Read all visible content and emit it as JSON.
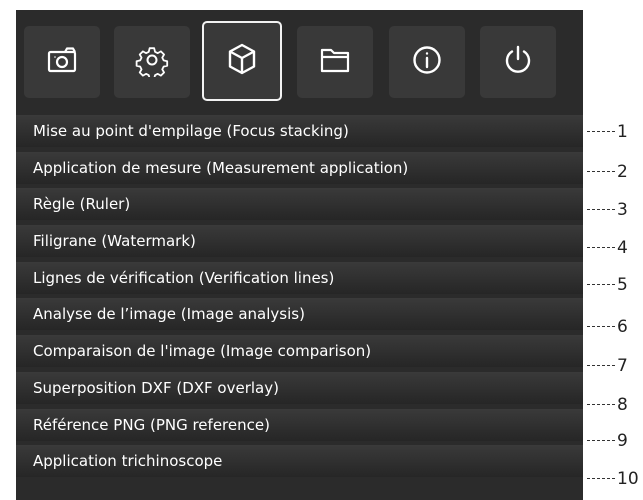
{
  "toolbar": {
    "buttons": [
      {
        "icon": "camera-icon",
        "selected": false
      },
      {
        "icon": "gear-icon",
        "selected": false
      },
      {
        "icon": "cube-icon",
        "selected": true
      },
      {
        "icon": "folder-icon",
        "selected": false
      },
      {
        "icon": "info-icon",
        "selected": false
      },
      {
        "icon": "power-icon",
        "selected": false
      }
    ]
  },
  "menu": {
    "items": [
      {
        "label": "Mise au point d'empilage (Focus stacking)",
        "callout": "1"
      },
      {
        "label": "Application de mesure (Measurement application)",
        "callout": "2"
      },
      {
        "label": "Règle (Ruler)",
        "callout": "3"
      },
      {
        "label": "Filigrane (Watermark)",
        "callout": "4"
      },
      {
        "label": "Lignes de vérification (Verification lines)",
        "callout": "5"
      },
      {
        "label": "Analyse de l’image (Image analysis)",
        "callout": "6"
      },
      {
        "label": "Comparaison de l'image (Image comparison)",
        "callout": "7"
      },
      {
        "label": "Superposition DXF (DXF overlay)",
        "callout": "8"
      },
      {
        "label": "Référence PNG (PNG reference)",
        "callout": "9"
      },
      {
        "label": "Application trichinoscope",
        "callout": "10"
      }
    ]
  },
  "colors": {
    "panel": "#2b2b2b",
    "button": "#393939",
    "selected_border": "#f2f2f2",
    "text": "#ffffff",
    "callout": "#222222"
  }
}
